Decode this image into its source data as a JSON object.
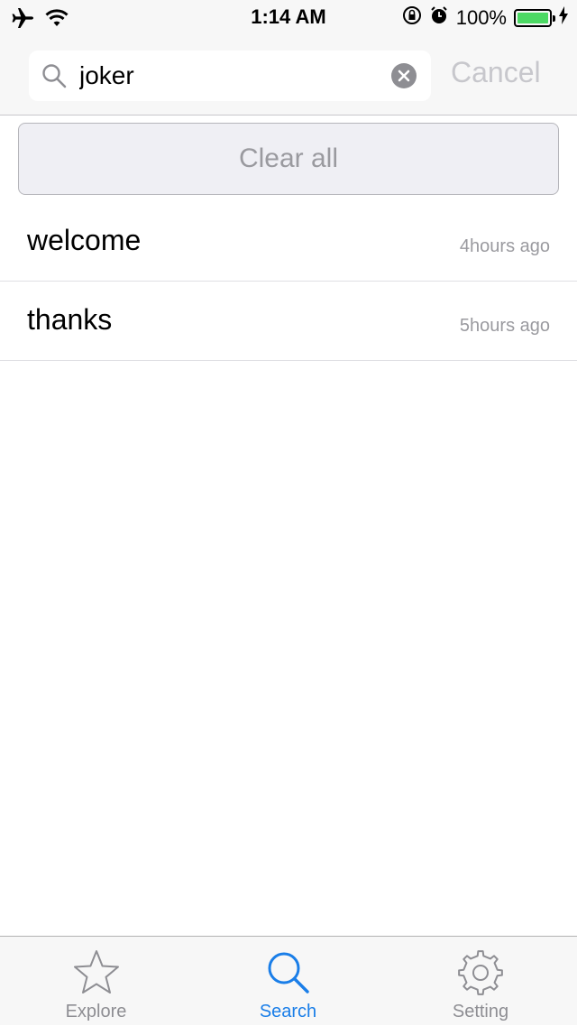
{
  "status_bar": {
    "time": "1:14 AM",
    "battery_percent": "100%",
    "battery_level": 1.0
  },
  "search": {
    "query": "joker",
    "cancel_label": "Cancel"
  },
  "clear_all_label": "Clear all",
  "history": [
    {
      "term": "welcome",
      "time": "4hours ago"
    },
    {
      "term": "thanks",
      "time": "5hours ago"
    }
  ],
  "tabs": [
    {
      "label": "Explore",
      "icon": "star-icon",
      "active": false
    },
    {
      "label": "Search",
      "icon": "search-icon",
      "active": true
    },
    {
      "label": "Setting",
      "icon": "gear-icon",
      "active": false
    }
  ],
  "colors": {
    "accent": "#1a7ee8",
    "battery": "#4cd964",
    "inactive": "#8e8e93"
  }
}
